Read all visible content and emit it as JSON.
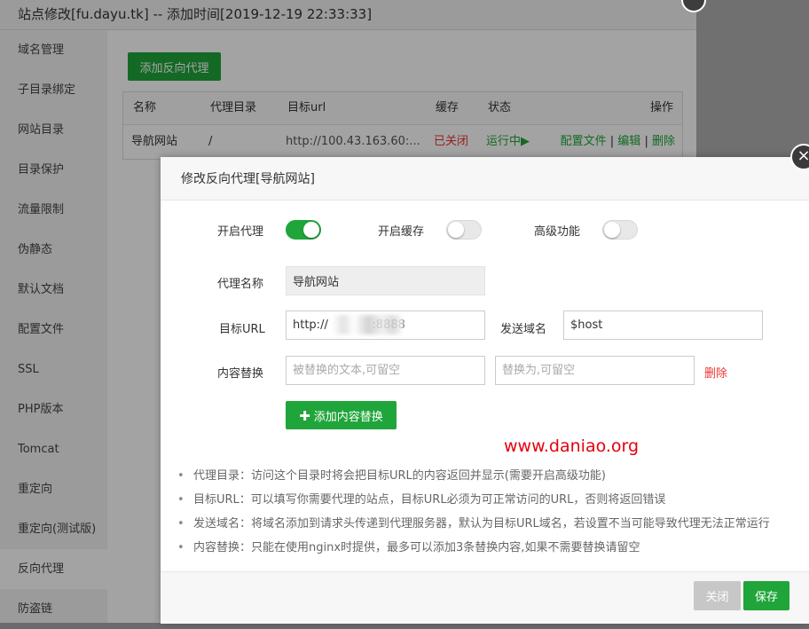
{
  "window": {
    "title": "站点修改[fu.dayu.tk] -- 添加时间[2019-12-19 22:33:33]"
  },
  "sidebar": {
    "items": [
      {
        "label": "域名管理"
      },
      {
        "label": "子目录绑定"
      },
      {
        "label": "网站目录"
      },
      {
        "label": "目录保护"
      },
      {
        "label": "流量限制"
      },
      {
        "label": "伪静态"
      },
      {
        "label": "默认文档"
      },
      {
        "label": "配置文件"
      },
      {
        "label": "SSL"
      },
      {
        "label": "PHP版本"
      },
      {
        "label": "Tomcat"
      },
      {
        "label": "重定向"
      },
      {
        "label": "重定向(测试版)"
      },
      {
        "label": "反向代理",
        "active": true
      },
      {
        "label": "防盗链"
      }
    ]
  },
  "main": {
    "add_button": "添加反向代理",
    "table": {
      "headers": [
        "名称",
        "代理目录",
        "目标url",
        "缓存",
        "状态",
        "操作"
      ],
      "rows": [
        {
          "name": "导航网站",
          "dir": "/",
          "url": "http://100.43.163.60:...",
          "cache": "已关闭",
          "status": "运行中",
          "status_icon": "play-icon",
          "action_config": "配置文件",
          "sep1": "|",
          "action_edit": "编辑",
          "sep2": "|",
          "action_delete": "删除"
        }
      ]
    }
  },
  "dialog": {
    "title": "修改反向代理[导航网站]",
    "toggles": {
      "proxy": {
        "label": "开启代理",
        "on": true
      },
      "cache": {
        "label": "开启缓存",
        "on": false
      },
      "advanced": {
        "label": "高级功能",
        "on": false
      }
    },
    "fields": {
      "name_label": "代理名称",
      "name_value": "导航网站",
      "url_label": "目标URL",
      "url_value": "http://            :8888",
      "domain_label": "发送域名",
      "domain_value": "$host",
      "replace_label": "内容替换",
      "replace_from_placeholder": "被替换的文本,可留空",
      "replace_to_placeholder": "替换为,可留空",
      "delete_label": "删除"
    },
    "add_replace_button": "添加内容替换",
    "watermark": "www.daniao.org",
    "tips": [
      "代理目录：访问这个目录时将会把目标URL的内容返回并显示(需要开启高级功能)",
      "目标URL：可以填写你需要代理的站点，目标URL必须为可正常访问的URL，否则将返回错误",
      "发送域名：将域名添加到请求头传递到代理服务器，默认为目标URL域名，若设置不当可能导致代理无法正常运行",
      "内容替换：只能在使用nginx时提供，最多可以添加3条替换内容,如果不需要替换请留空"
    ],
    "close_button": "关闭",
    "save_button": "保存"
  },
  "colors": {
    "accent_green": "#20a53a",
    "danger_red": "#e33333",
    "watermark_red": "#e4000f"
  }
}
